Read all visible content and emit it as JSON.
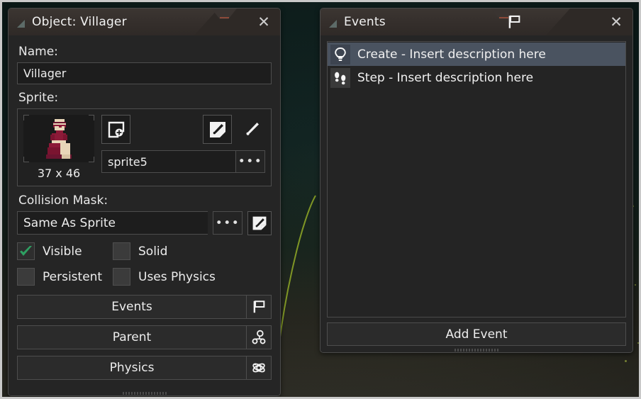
{
  "background": {
    "scene_accent_color": "#8fa03c",
    "base_color": "#0d201e"
  },
  "object_window": {
    "title": "Object: Villager",
    "titlebar_corner_icon": "resize-triangle-icon",
    "close_label": "✕",
    "name": {
      "label": "Name:",
      "value": "Villager"
    },
    "sprite": {
      "label": "Sprite:",
      "dimensions": "37 x 46",
      "name_value": "sprite5",
      "ellipsis_label": "•••",
      "new_sprite_icon": "new-sprite-icon",
      "edit_sprite_icon": "edit-sprite-icon",
      "paint_sprite_icon": "paint-brush-icon"
    },
    "collision": {
      "label": "Collision Mask:",
      "value": "Same As Sprite",
      "ellipsis_label": "•••",
      "edit_icon": "edit-mask-brush-icon"
    },
    "checkboxes": [
      {
        "label": "Visible",
        "checked": true
      },
      {
        "label": "Solid",
        "checked": false
      },
      {
        "label": "Persistent",
        "checked": false
      },
      {
        "label": "Uses Physics",
        "checked": false
      }
    ],
    "buttons": [
      {
        "label": "Events",
        "icon": "flag-icon"
      },
      {
        "label": "Parent",
        "icon": "parent-hierarchy-icon"
      },
      {
        "label": "Physics",
        "icon": "atom-icon"
      }
    ]
  },
  "events_window": {
    "title": "Events",
    "titlebar_icon": "flag-icon",
    "titlebar_corner_icon": "resize-triangle-icon",
    "close_label": "✕",
    "events": [
      {
        "icon": "lightbulb-icon",
        "text": "Create - Insert description here",
        "selected": true
      },
      {
        "icon": "footsteps-icon",
        "text": "Step - Insert description here",
        "selected": false
      }
    ],
    "add_event_label": "Add Event"
  }
}
